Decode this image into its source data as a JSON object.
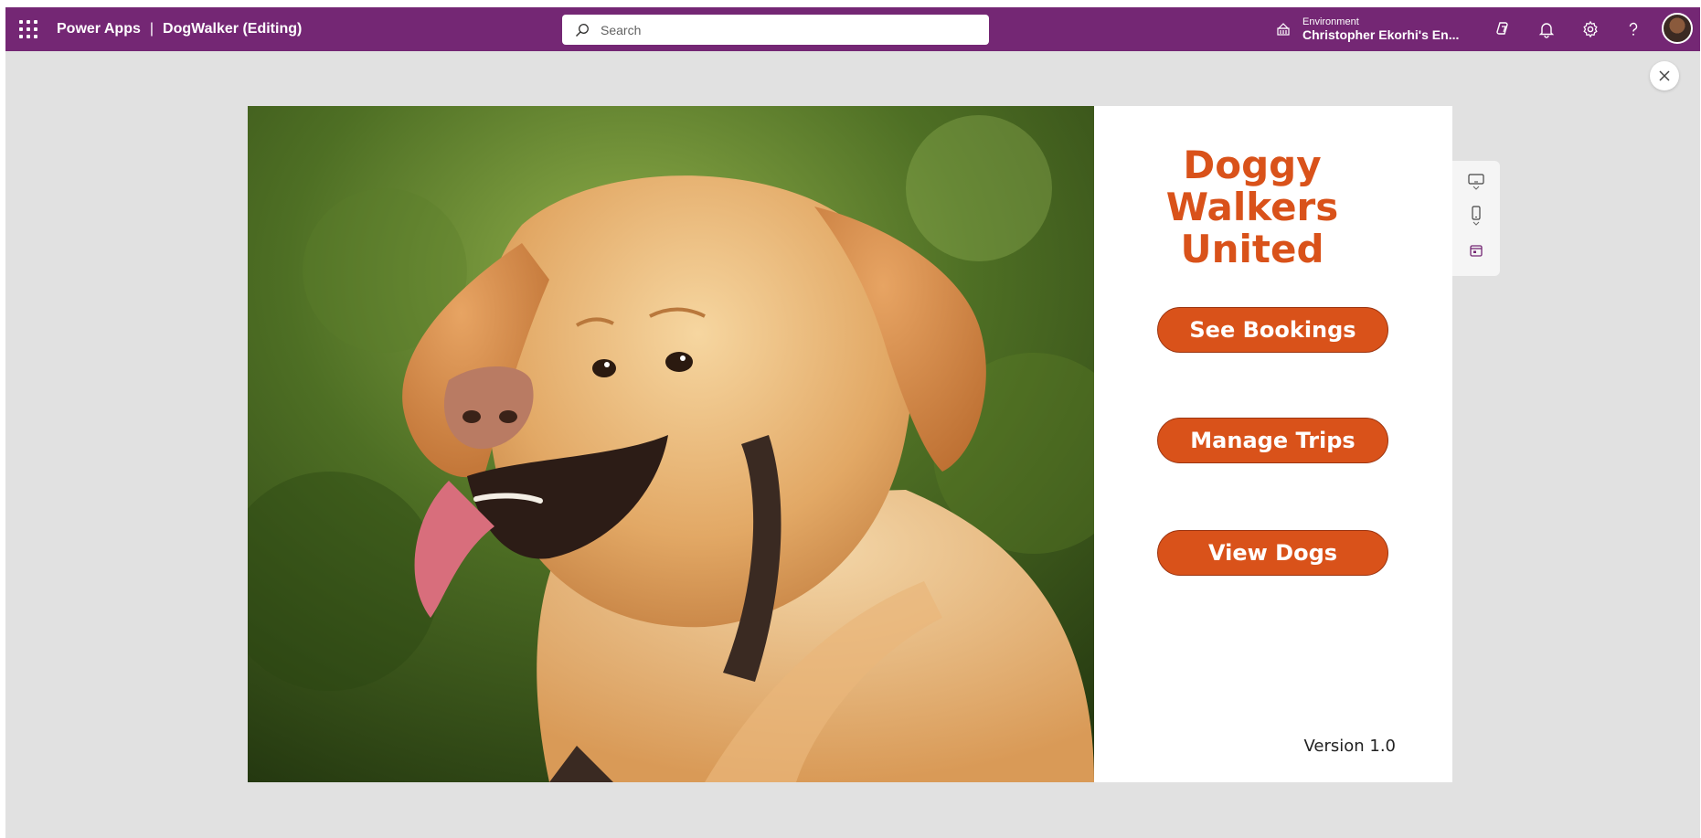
{
  "header": {
    "app_name": "Power Apps",
    "separator": "|",
    "document_title": "DogWalker (Editing)",
    "search_placeholder": "Search",
    "environment_label": "Environment",
    "environment_name": "Christopher Ekorhi's En..."
  },
  "app_screen": {
    "title_line1": "Doggy Walkers",
    "title_line2": "United",
    "buttons": [
      "See Bookings",
      "Manage Trips",
      "View Dogs"
    ],
    "version": "Version 1.0",
    "accent_color": "#d9521a"
  },
  "theme": {
    "header_bg": "#742774",
    "workspace_bg": "#e1e1e1"
  },
  "icons": [
    "app-launcher-icon",
    "search-icon",
    "environment-icon",
    "copilot-icon",
    "bell-icon",
    "gear-icon",
    "help-icon",
    "close-icon",
    "tablet-layout-icon",
    "phone-layout-icon",
    "calendar-icon"
  ]
}
